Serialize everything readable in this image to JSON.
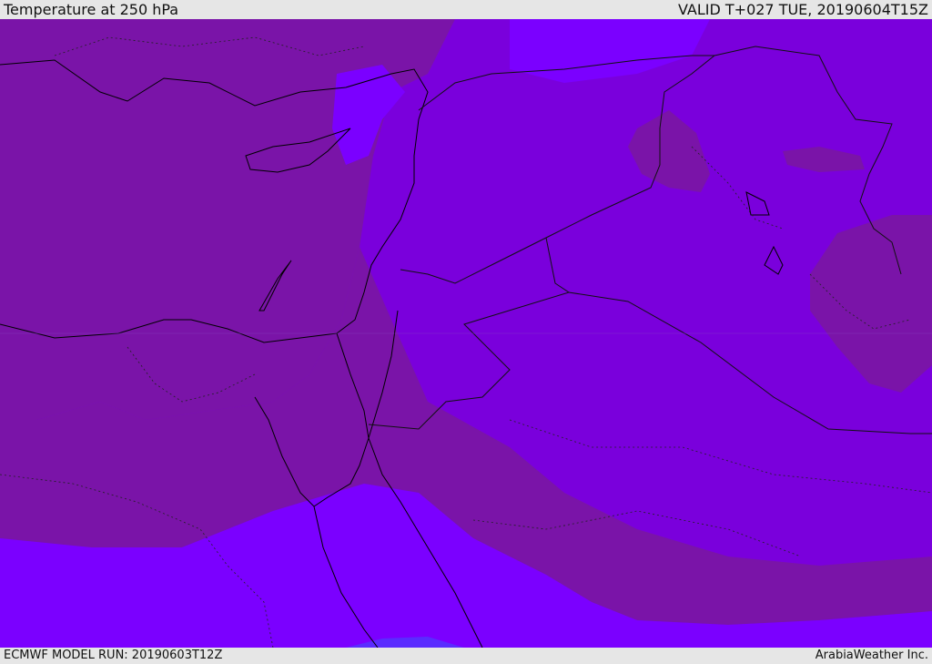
{
  "header": {
    "title": "Temperature at 250 hPa",
    "valid_time": "VALID T+027 TUE, 20190604T15Z"
  },
  "footer": {
    "model_run": "ECMWF MODEL RUN: 20190603T12Z",
    "provider": "ArabiaWeather Inc."
  },
  "map": {
    "variable": "temperature",
    "level": "250 hPa",
    "colors": {
      "coldest_band": "#7a14a8",
      "mid_band": "#7a00dc",
      "warm_band": "#7b00ff",
      "warmest_spot": "#5a2cff",
      "coastline": "#000000",
      "border": "#222222"
    }
  }
}
